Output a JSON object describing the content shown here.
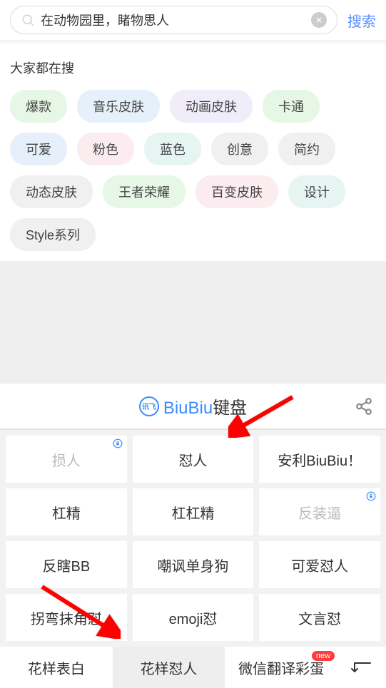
{
  "search": {
    "value": "在动物园里，睹物思人",
    "button": "搜索"
  },
  "trending": {
    "title": "大家都在搜",
    "tags": [
      {
        "label": "爆款",
        "style": "green"
      },
      {
        "label": "音乐皮肤",
        "style": "blue"
      },
      {
        "label": "动画皮肤",
        "style": "purple"
      },
      {
        "label": "卡通",
        "style": "green"
      },
      {
        "label": "可爱",
        "style": "blue"
      },
      {
        "label": "粉色",
        "style": "pink"
      },
      {
        "label": "蓝色",
        "style": "teal"
      },
      {
        "label": "创意",
        "style": "gray"
      },
      {
        "label": "简约",
        "style": "gray"
      },
      {
        "label": "动态皮肤",
        "style": "gray"
      },
      {
        "label": "王者荣耀",
        "style": "green"
      },
      {
        "label": "百变皮肤",
        "style": "pink"
      },
      {
        "label": "设计",
        "style": "teal"
      },
      {
        "label": "Style系列",
        "style": "gray"
      }
    ]
  },
  "keyboard": {
    "logo_text": "讯飞",
    "title_biu": "BiuBiu",
    "title_rest": "键盘",
    "grid": [
      {
        "label": "损人",
        "locked": true
      },
      {
        "label": "怼人",
        "locked": false
      },
      {
        "label": "安利BiuBiu！",
        "locked": false
      },
      {
        "label": "杠精",
        "locked": false
      },
      {
        "label": "杠杠精",
        "locked": false
      },
      {
        "label": "反装逼",
        "locked": true
      },
      {
        "label": "反瞎BB",
        "locked": false
      },
      {
        "label": "嘲讽单身狗",
        "locked": false
      },
      {
        "label": "可爱怼人",
        "locked": false
      },
      {
        "label": "拐弯抹角怼",
        "locked": false
      },
      {
        "label": "emoji怼",
        "locked": false
      },
      {
        "label": "文言怼",
        "locked": false
      }
    ],
    "tabs": [
      {
        "label": "花样表白",
        "active": false,
        "badge": null
      },
      {
        "label": "花样怼人",
        "active": true,
        "badge": null
      },
      {
        "label": "微信翻译彩蛋",
        "active": false,
        "badge": "new"
      }
    ]
  }
}
